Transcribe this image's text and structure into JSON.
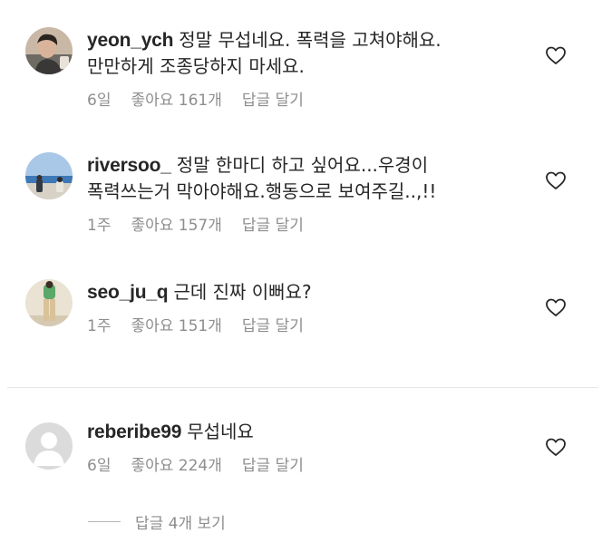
{
  "comments": [
    {
      "username": "yeon_ych",
      "text": "정말 무섭네요. 폭력을 고쳐야해요. 만만하게 조종당하지 마세요.",
      "time": "6일",
      "likes": "좋아요 161개",
      "reply": "답글 달기"
    },
    {
      "username": "riversoo_",
      "text": "정말 한마디 하고 싶어요...우경이 폭력쓰는거 막아야해요.행동으로 보여주길..,!!",
      "time": "1주",
      "likes": "좋아요 157개",
      "reply": "답글 달기"
    },
    {
      "username": "seo_ju_q",
      "text": "근데 진짜 이뻐요?",
      "time": "1주",
      "likes": "좋아요 151개",
      "reply": "답글 달기"
    },
    {
      "username": "reberibe99",
      "text": "무섭네요",
      "time": "6일",
      "likes": "좋아요 224개",
      "reply": "답글 달기"
    }
  ],
  "view_replies_label": "답글 4개 보기",
  "icons": {
    "like": "heart-outline-icon",
    "default_avatar": "default-avatar-icon"
  },
  "colors": {
    "text": "#262626",
    "secondary": "#8e8e8e",
    "divider": "#e6e6e6"
  }
}
